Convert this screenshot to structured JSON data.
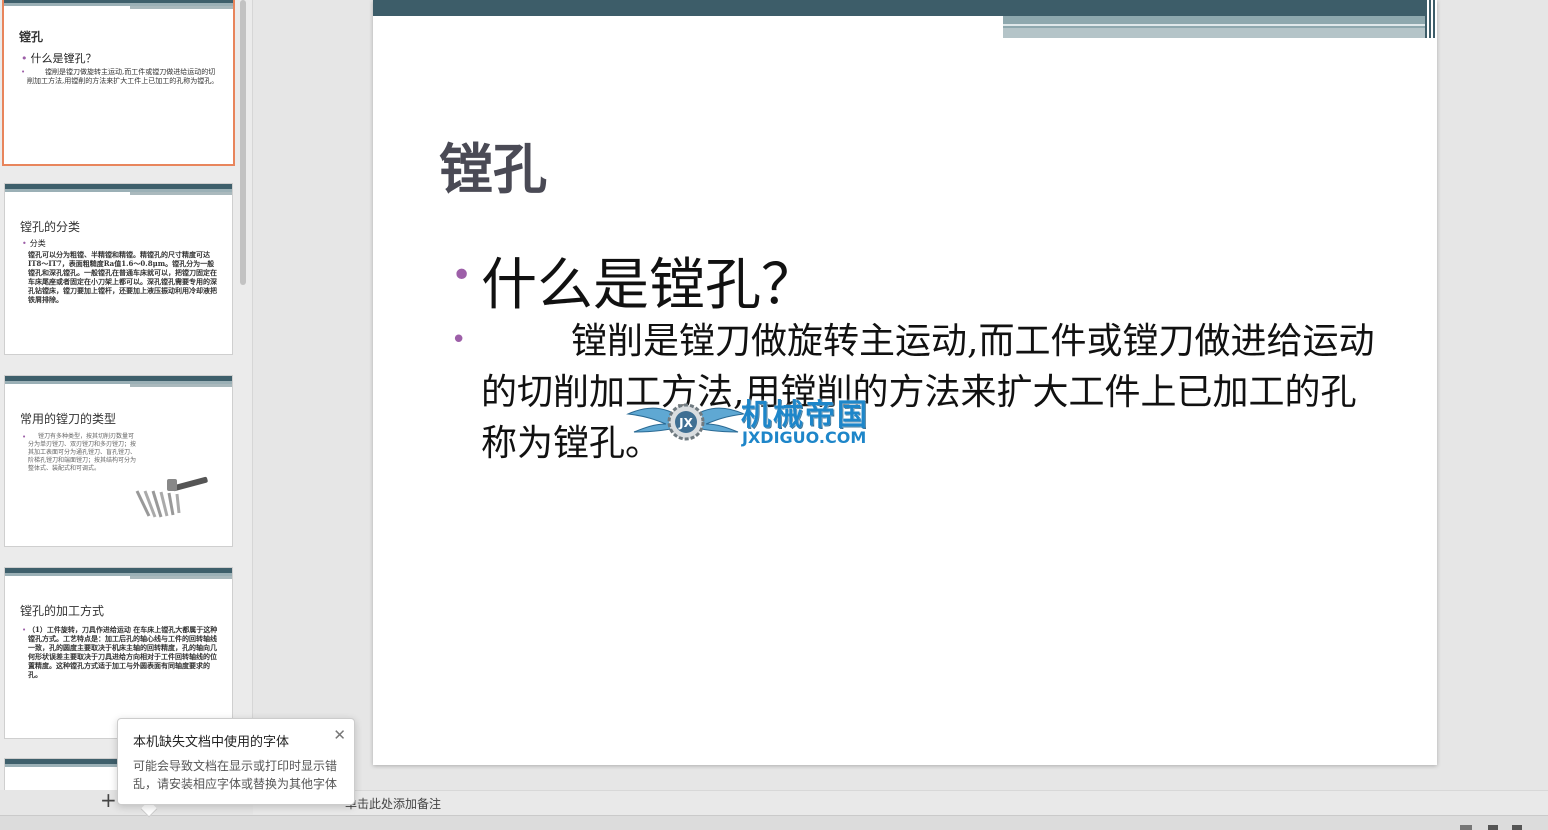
{
  "thumbnails": [
    {
      "title": "镗孔",
      "bullet": "什么是镗孔？",
      "body": "镗削是镗刀做旋转主运动,而工件或镗刀做进给运动的切削加工方法,用镗削的方法来扩大工件上已加工的孔称为镗孔。"
    },
    {
      "title": "镗孔的分类",
      "bullet": "分类",
      "body": "镗孔可以分为粗镗、半精镗和精镗。精镗孔的尺寸精度可达IT8～IT7，表面粗糙度Ra值1.6～0.8μm。镗孔分为一般镗孔和深孔镗孔。一般镗孔在普通车床就可以，把镗刀固定在车床尾座或者固定在小刀架上都可以。深孔镗孔需要专用的深孔钻镗床，镗刀要加上镗杆，还要加上液压振动利用冷却液把铁屑排除。"
    },
    {
      "title": "常用的镗刀的类型",
      "body": "镗刀有多种类型，按其切削刃数量可分为单刃镗刀、双刃镗刀和多刃镗刀；按其加工表面可分为通孔镗刀、盲孔镗刀、阶梯孔镗刀和端面镗刀；按其结构可分为整体式、装配式和可调式。"
    },
    {
      "title": "镗孔的加工方式",
      "body": "（1）工件旋转，刀具作进给运动 在车床上镗孔大都属于这种镗孔方式。工艺特点是：加工后孔的轴心线与工件的回转轴线一致，孔的圆度主要取决于机床主轴的回转精度，孔的轴向几何形状误差主要取决于刀具进给方向相对于工件回转轴线的位置精度。这种镗孔方式适于加工与外圆表面有同轴度要求的孔。"
    }
  ],
  "slide": {
    "title": "镗孔",
    "bullet1": "什么是镗孔？",
    "body": "镗削是镗刀做旋转主运动,而工件或镗刀做进给运动的切削加工方法,用镗削的方法来扩大工件上已加工的孔称为镗孔。"
  },
  "watermark": {
    "text": "机械帝国",
    "url": "JXDIGUO.COM",
    "badge": "JX"
  },
  "notes": {
    "placeholder": "单击此处添加备注"
  },
  "popup": {
    "title": "本机缺失文档中使用的字体",
    "message": "可能会导致文档在显示或打印时显示错乱，请安装相应字体或替换为其他字体"
  },
  "colors": {
    "accent_bar": "#3d5d69",
    "bullet": "#9d5fa8",
    "selection": "#e8855c"
  }
}
